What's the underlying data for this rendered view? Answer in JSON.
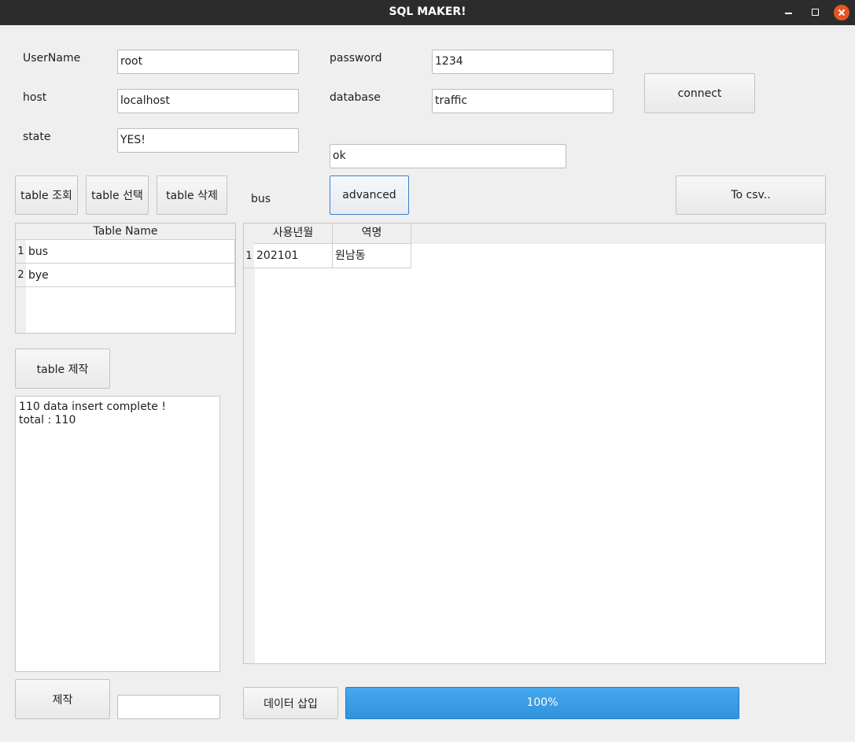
{
  "window": {
    "title": "SQL MAKER!"
  },
  "form": {
    "username_label": "UserName",
    "username_value": "root",
    "password_label": "password",
    "password_value": "1234",
    "host_label": "host",
    "host_value": "localhost",
    "database_label": "database",
    "database_value": "traffic",
    "state_label": "state",
    "state_value": "YES!",
    "connect_button": "connect",
    "status_value": "ok"
  },
  "toolbar": {
    "view_table": "table 조회",
    "select_table": "table 선택",
    "delete_table": "table 삭제",
    "selected_table": "bus",
    "advanced": "advanced",
    "to_csv": "To csv.."
  },
  "table_list": {
    "header": "Table Name",
    "rows": [
      {
        "num": "1",
        "name": "bus"
      },
      {
        "num": "2",
        "name": "bye"
      }
    ]
  },
  "create_table_button": "table 제작",
  "log": {
    "lines": [
      "110 data insert complete !",
      "total : 110"
    ]
  },
  "data_grid": {
    "headers": [
      "사용년월",
      "역명"
    ],
    "rows": [
      {
        "num": "1",
        "cells": [
          "202101",
          "원남동"
        ]
      }
    ]
  },
  "bottom": {
    "make_button": "제작",
    "make_input": "",
    "insert_button": "데이터 삽입",
    "progress_text": "100%",
    "progress_value": 1.0
  },
  "colors": {
    "titlebar": "#2c2c2c",
    "close_button": "#e95420",
    "progress": "#3399e6"
  }
}
